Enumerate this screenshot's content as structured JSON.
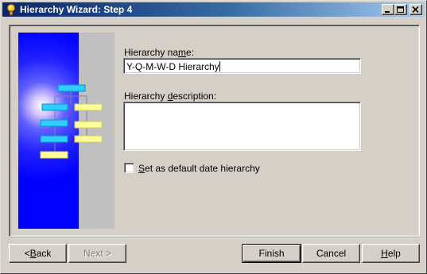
{
  "window": {
    "title": "Hierarchy Wizard: Step 4",
    "controls": {
      "minimize": "minimize",
      "maximize": "maximize",
      "close": "close"
    }
  },
  "form": {
    "name_label_before": "Hierarchy na",
    "name_label_mnemonic": "m",
    "name_label_after": "e:",
    "name_value": "Y-Q-M-W-D Hierarchy",
    "description_label_before": "Hierarchy ",
    "description_label_mnemonic": "d",
    "description_label_after": "escription:",
    "description_value": "",
    "default_checkbox_mnemonic": "S",
    "default_checkbox_rest": "et as default date hierarchy",
    "default_checked": false
  },
  "buttons": {
    "back_mnemonic": "B",
    "back_rest": "ack",
    "back_prefix": "< ",
    "next_label": "Next >",
    "finish_label": "Finish",
    "cancel_label": "Cancel",
    "help_mnemonic": "H",
    "help_rest": "elp"
  },
  "colors": {
    "title_gradient_start": "#0a246a",
    "title_gradient_end": "#a6caf0",
    "art_blue": "#0000ff",
    "node_cyan": "#33ccff",
    "node_yellow": "#ffff99"
  }
}
